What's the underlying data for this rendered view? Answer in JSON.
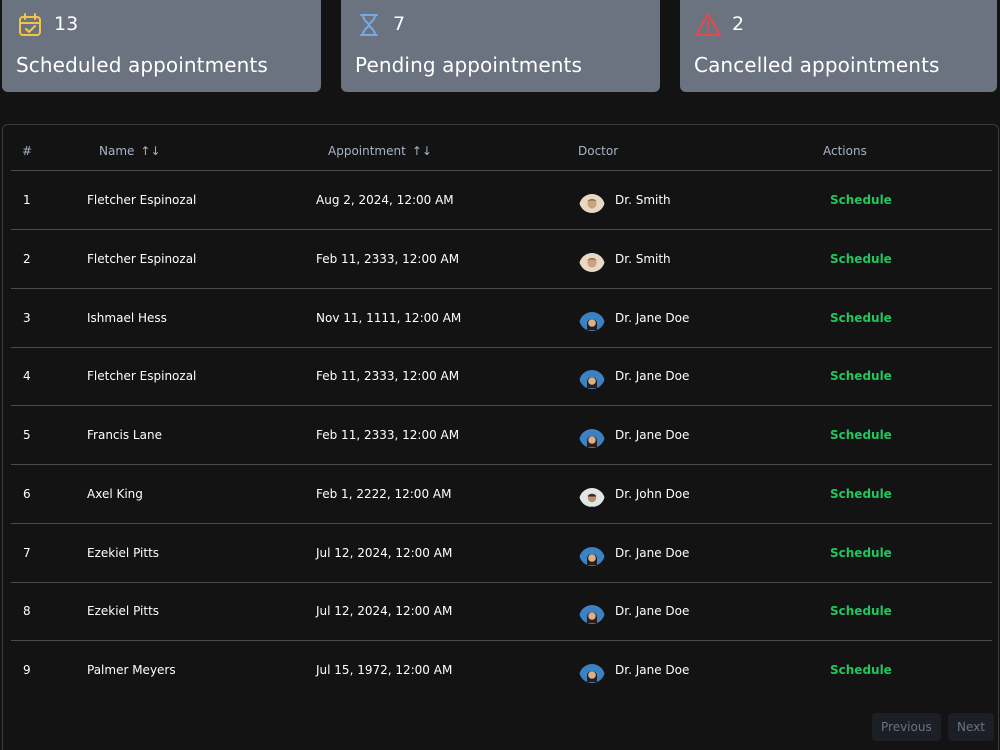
{
  "stats": {
    "scheduled": {
      "count": "13",
      "label": "Scheduled appointments",
      "icon": "calendar-check-icon",
      "color": "#f5c542"
    },
    "pending": {
      "count": "7",
      "label": "Pending appointments",
      "icon": "hourglass-icon",
      "color": "#7aa7e6"
    },
    "cancelled": {
      "count": "2",
      "label": "Cancelled appointments",
      "icon": "warning-triangle-icon",
      "color": "#e5484d"
    }
  },
  "table": {
    "headers": {
      "num": "#",
      "name": "Name",
      "appointment": "Appointment",
      "doctor": "Doctor",
      "actions": "Actions"
    },
    "sort_icon": "↑↓",
    "rows": [
      {
        "num": "1",
        "name": "Fletcher Espinozal",
        "appointment": "Aug 2, 2024, 12:00 AM",
        "doctor": "Dr. Smith",
        "avatar": "smith",
        "action": "Schedule"
      },
      {
        "num": "2",
        "name": "Fletcher Espinozal",
        "appointment": "Feb 11, 2333, 12:00 AM",
        "doctor": "Dr. Smith",
        "avatar": "smith",
        "action": "Schedule"
      },
      {
        "num": "3",
        "name": "Ishmael Hess",
        "appointment": "Nov 11, 1111, 12:00 AM",
        "doctor": "Dr. Jane Doe",
        "avatar": "jane",
        "action": "Schedule"
      },
      {
        "num": "4",
        "name": "Fletcher Espinozal",
        "appointment": "Feb 11, 2333, 12:00 AM",
        "doctor": "Dr. Jane Doe",
        "avatar": "jane",
        "action": "Schedule"
      },
      {
        "num": "5",
        "name": "Francis Lane",
        "appointment": "Feb 11, 2333, 12:00 AM",
        "doctor": "Dr. Jane Doe",
        "avatar": "jane",
        "action": "Schedule"
      },
      {
        "num": "6",
        "name": "Axel King",
        "appointment": "Feb 1, 2222, 12:00 AM",
        "doctor": "Dr. John Doe",
        "avatar": "john",
        "action": "Schedule"
      },
      {
        "num": "7",
        "name": "Ezekiel Pitts",
        "appointment": "Jul 12, 2024, 12:00 AM",
        "doctor": "Dr. Jane Doe",
        "avatar": "jane",
        "action": "Schedule"
      },
      {
        "num": "8",
        "name": "Ezekiel Pitts",
        "appointment": "Jul 12, 2024, 12:00 AM",
        "doctor": "Dr. Jane Doe",
        "avatar": "jane",
        "action": "Schedule"
      },
      {
        "num": "9",
        "name": "Palmer Meyers",
        "appointment": "Jul 15, 1972, 12:00 AM",
        "doctor": "Dr. Jane Doe",
        "avatar": "jane",
        "action": "Schedule"
      }
    ]
  },
  "pagination": {
    "previous": "Previous",
    "next": "Next"
  },
  "colors": {
    "action": "#22c55e",
    "card_bg": "#6b7280",
    "page_bg": "#131313"
  }
}
